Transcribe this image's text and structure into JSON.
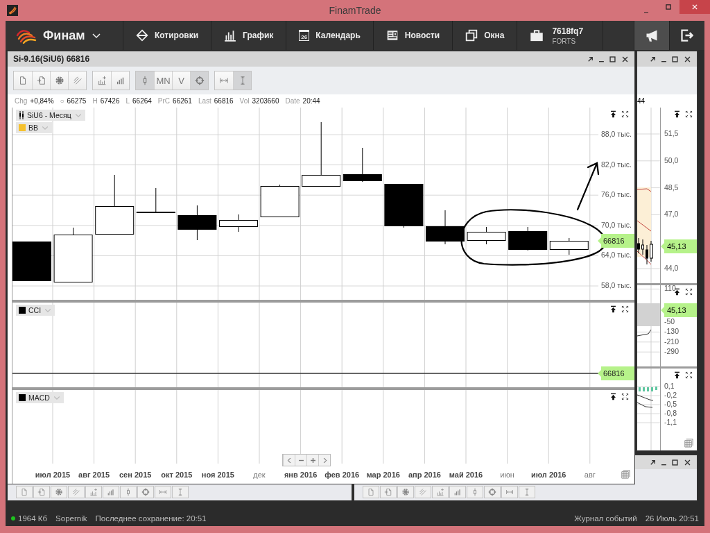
{
  "window": {
    "title": "FinamTrade"
  },
  "nav": {
    "brand": "Финам",
    "items": [
      {
        "kind": "quotes",
        "label": "Котировки"
      },
      {
        "kind": "chart",
        "label": "График"
      },
      {
        "kind": "calendar",
        "label": "Календарь",
        "badge": "26"
      },
      {
        "kind": "news",
        "label": "Новости"
      },
      {
        "kind": "windows",
        "label": "Окна"
      }
    ],
    "account": {
      "name": "7618fq7",
      "market": "FORTS"
    },
    "actions": [
      {
        "kind": "megaphone",
        "selected": true
      },
      {
        "kind": "exit",
        "selected": false
      }
    ]
  },
  "chart_window": {
    "title": "Si-9.16(SiU6) 66816",
    "toolbar": [
      {
        "buttons": [
          {
            "kind": "new",
            "selected": false
          },
          {
            "kind": "template",
            "selected": false
          },
          {
            "kind": "settings",
            "selected": false
          },
          {
            "kind": "drawing",
            "selected": false
          }
        ]
      },
      {
        "buttons": [
          {
            "kind": "add-indicator",
            "selected": false
          },
          {
            "kind": "bars",
            "selected": false
          }
        ]
      },
      {
        "buttons": [
          {
            "kind": "candle",
            "selected": true
          },
          {
            "kind": "text",
            "label": "MN",
            "selected": false
          },
          {
            "kind": "text",
            "label": "V",
            "selected": false
          },
          {
            "kind": "crosshair",
            "selected": true
          }
        ]
      },
      {
        "buttons": [
          {
            "kind": "fit-width",
            "selected": false
          },
          {
            "kind": "fit-height",
            "selected": true
          }
        ]
      }
    ],
    "quote": [
      {
        "label": "Chg",
        "value": "+0,84%"
      },
      {
        "label": "○",
        "value": "66275"
      },
      {
        "label": "H",
        "value": "67426"
      },
      {
        "label": "L",
        "value": "66264"
      },
      {
        "label": "PrC",
        "value": "66261"
      },
      {
        "label": "Last",
        "value": "66816"
      },
      {
        "label": "Vol",
        "value": "3203660"
      },
      {
        "label": "Date",
        "value": "20:44"
      }
    ],
    "panes": [
      {
        "kind": "price",
        "legend": [
          {
            "kind": "series",
            "label": "SiU6 - Месяц"
          },
          {
            "kind": "indicator",
            "label": "BB",
            "color": "#f5c12e"
          }
        ],
        "axis": [
          "88,0 тыс.",
          "82,0 тыс.",
          "76,0 тыс.",
          "70,0 тыс.",
          "64,0 тыс.",
          "58,0 тыс."
        ],
        "marker": "66816"
      },
      {
        "kind": "cci",
        "legend": [
          {
            "kind": "indicator",
            "label": "CCI",
            "color": "#000000"
          }
        ],
        "marker": "66816"
      },
      {
        "kind": "macd",
        "legend": [
          {
            "kind": "indicator",
            "label": "MACD",
            "color": "#000000"
          }
        ]
      }
    ],
    "months": [
      {
        "label": "июл 2015",
        "muted": false
      },
      {
        "label": "авг 2015",
        "muted": false
      },
      {
        "label": "сен 2015",
        "muted": false
      },
      {
        "label": "окт 2015",
        "muted": false
      },
      {
        "label": "ноя 2015",
        "muted": false
      },
      {
        "label": "дек",
        "muted": true
      },
      {
        "label": "янв 2016",
        "muted": false
      },
      {
        "label": "фев 2016",
        "muted": false
      },
      {
        "label": "мар 2016",
        "muted": false
      },
      {
        "label": "апр 2016",
        "muted": false
      },
      {
        "label": "май 2016",
        "muted": false
      },
      {
        "label": "июн",
        "muted": true
      },
      {
        "label": "июл 2016",
        "muted": false
      },
      {
        "label": "авг",
        "muted": true
      }
    ]
  },
  "side_window": {
    "quote_fragment": "44",
    "panes": [
      {
        "kind": "price",
        "axis": [
          "51,5",
          "50,0",
          "48,5",
          "47,0",
          "44,0"
        ],
        "marker": "45,13"
      },
      {
        "kind": "cci",
        "axis": [
          "110",
          "-50",
          "-130",
          "-210",
          "-290"
        ],
        "marker": "45,13"
      },
      {
        "kind": "macd",
        "axis": [
          "0,1",
          "-0,2",
          "-0,5",
          "-0,8",
          "-1,1"
        ]
      }
    ]
  },
  "status_bar": {
    "online": true,
    "memory": "1964 Кб",
    "user": "Sopernik",
    "save": "Последнее сохранение: 20:51",
    "journal": "Журнал событий",
    "datetime": "26 Июль 20:51"
  }
}
